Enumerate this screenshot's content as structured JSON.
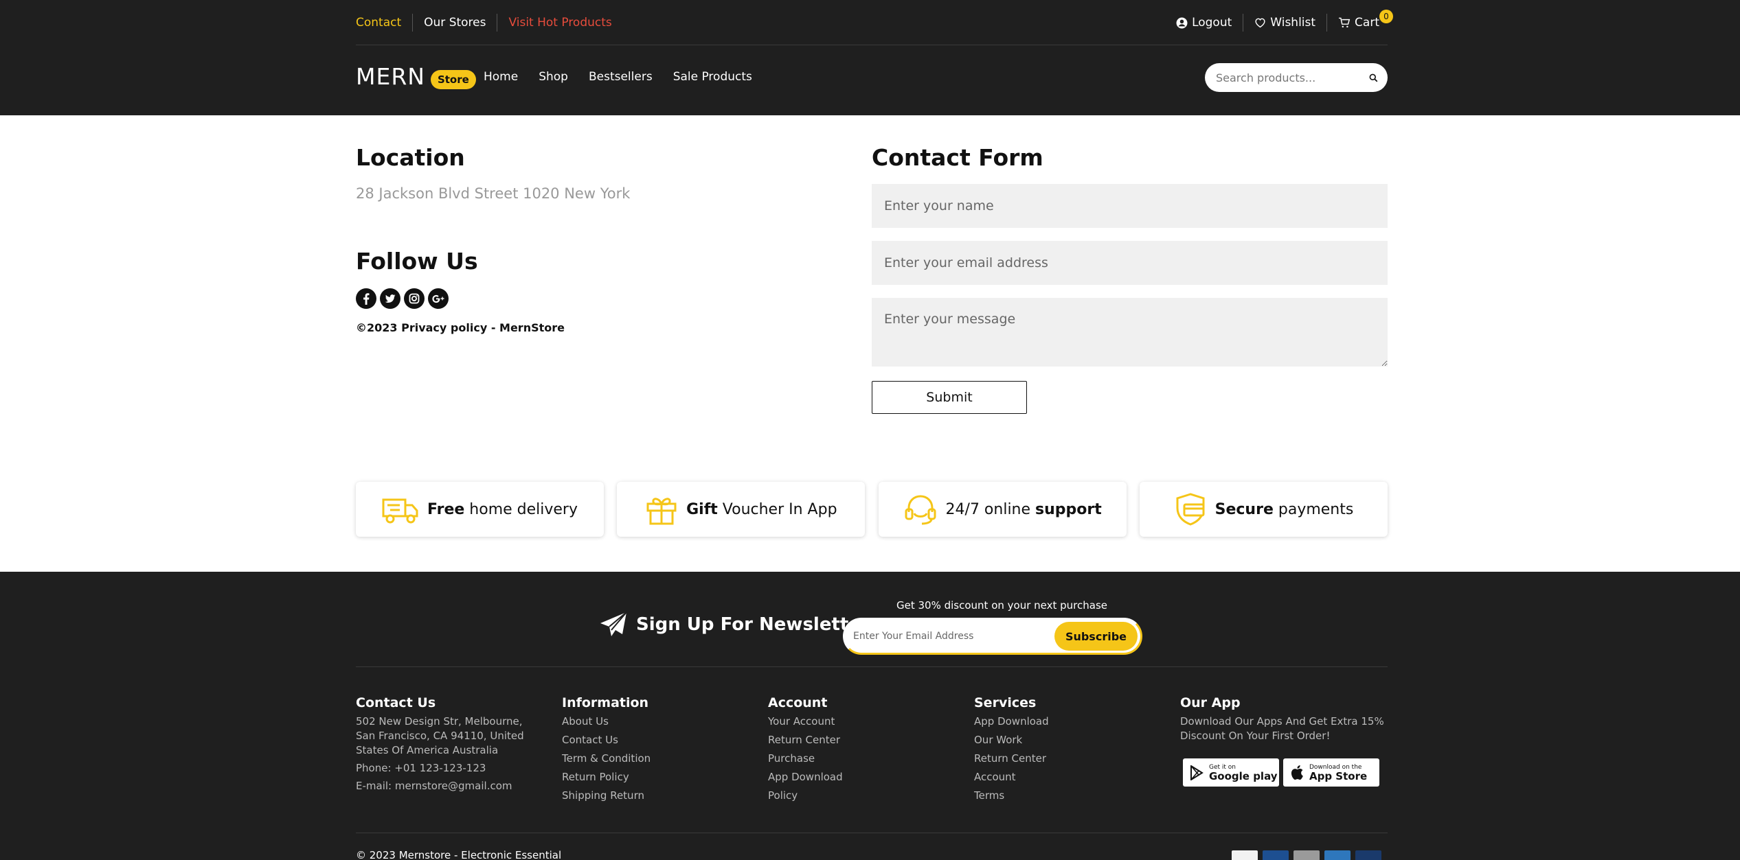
{
  "topbar": {
    "links": [
      {
        "label": "Contact",
        "color": "#f5c518"
      },
      {
        "label": "Our Stores",
        "color": "#ffffff"
      },
      {
        "label": "Visit Hot Products",
        "color": "#e74c3c"
      }
    ],
    "logout_label": "Logout",
    "wishlist_label": "Wishlist",
    "cart_label": "Cart",
    "cart_count": "0"
  },
  "brand": {
    "name": "MERN",
    "pill": "Store"
  },
  "nav": {
    "items": [
      "Home",
      "Shop",
      "Bestsellers",
      "Sale Products"
    ]
  },
  "search": {
    "placeholder": "Search products..."
  },
  "location": {
    "title": "Location",
    "address": "28 Jackson Blvd Street 1020 New York"
  },
  "follow": {
    "title": "Follow Us",
    "icons": [
      "facebook-icon",
      "twitter-icon",
      "instagram-icon",
      "google-plus-icon"
    ],
    "copyright": "©2023 Privacy policy - MernStore"
  },
  "contact_form": {
    "title": "Contact Form",
    "name_placeholder": "Enter your name",
    "email_placeholder": "Enter your email address",
    "message_placeholder": "Enter your message",
    "submit_label": "Submit"
  },
  "features": [
    {
      "icon": "truck-icon",
      "bold": "Free",
      "rest": " home delivery"
    },
    {
      "icon": "gift-icon",
      "bold": "Gift",
      "rest": " Voucher In App"
    },
    {
      "icon": "headset-icon",
      "pre": "24/7 online ",
      "bold": "support"
    },
    {
      "icon": "shield-card-icon",
      "bold": "Secure",
      "rest": " payments"
    }
  ],
  "newsletter": {
    "title": "Sign Up For Newsletter",
    "promo": "Get 30% discount on your next purchase",
    "email_placeholder": "Enter Your Email Address",
    "subscribe_label": "Subscribe"
  },
  "footer": {
    "contact": {
      "title": "Contact Us",
      "address": "502 New Design Str, Melbourne, San Francisco, CA 94110, United States Of America Australia",
      "phone": "Phone: +01 123-123-123",
      "email": "E-mail: mernstore@gmail.com"
    },
    "information": {
      "title": "Information",
      "links": [
        "About Us",
        "Contact Us",
        "Term & Condition",
        "Return Policy",
        "Shipping Return"
      ]
    },
    "account": {
      "title": "Account",
      "links": [
        "Your Account",
        "Return Center",
        "Purchase",
        "App Download",
        "Policy"
      ]
    },
    "services": {
      "title": "Services",
      "links": [
        "App Download",
        "Our Work",
        "Return Center",
        "Account",
        "Terms"
      ]
    },
    "app": {
      "title": "Our App",
      "text": "Download Our Apps And Get Extra 15% Discount On Your First Order!",
      "google": {
        "small": "Get it on",
        "big": "Google play"
      },
      "apple": {
        "small": "Download on the",
        "big": "App Store"
      }
    },
    "copyright": "© 2023 Mernstore - Electronic Essential",
    "payments": [
      {
        "name": "visa-icon",
        "color": "#f2f2f2"
      },
      {
        "name": "maestro-icon",
        "color": "#1d4f91"
      },
      {
        "name": "generic-card-icon",
        "color": "#9a9a9a"
      },
      {
        "name": "amex-icon",
        "color": "#2e77bc"
      },
      {
        "name": "mastercard-icon",
        "color": "#1a3a6b"
      }
    ]
  },
  "colors": {
    "accent": "#f5c518",
    "dark": "#1f1f1f",
    "hot": "#e74c3c"
  }
}
